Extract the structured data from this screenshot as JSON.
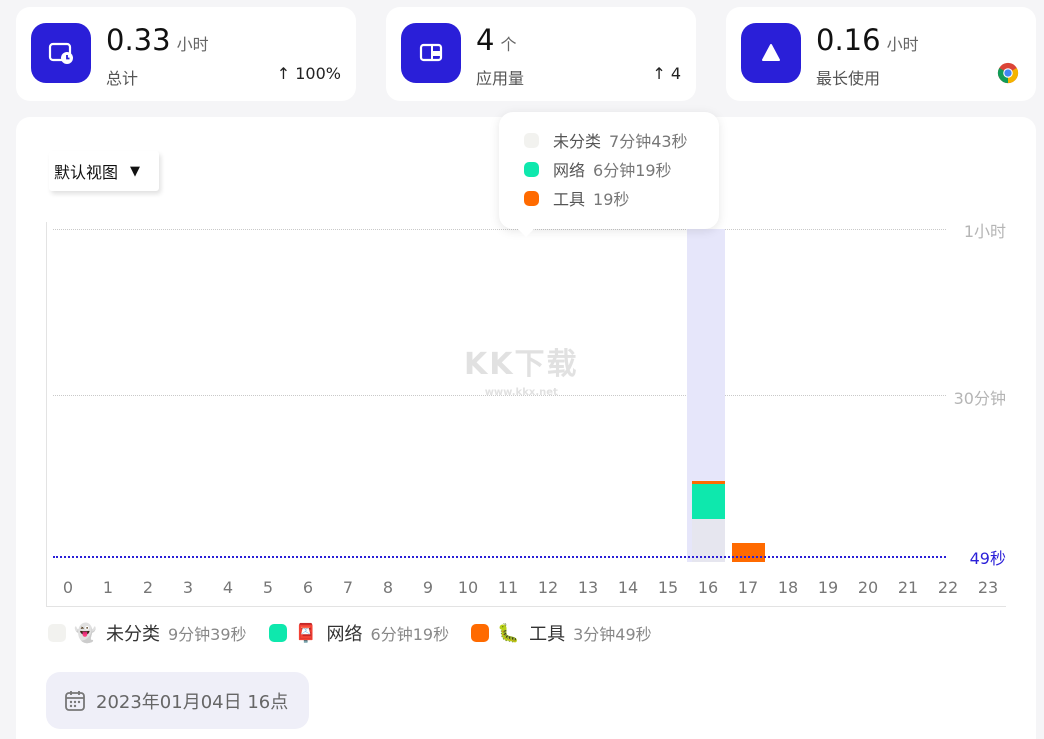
{
  "stats": {
    "total": {
      "value": "0.33",
      "unit": "小时",
      "label": "总计",
      "trend": "100%",
      "icon": "clock-screen-icon"
    },
    "apps": {
      "value": "4",
      "unit": "个",
      "label": "应用量",
      "trend": "4",
      "icon": "app-window-icon"
    },
    "longest": {
      "value": "0.16",
      "unit": "小时",
      "label": "最长使用",
      "icon": "triangle-icon",
      "app_icon": "chrome-icon"
    }
  },
  "view_select": {
    "value": "默认视图"
  },
  "tooltip": {
    "rows": [
      {
        "name": "未分类",
        "time": "7分钟43秒",
        "color": "#f2f2ef"
      },
      {
        "name": "网络",
        "time": "6分钟19秒",
        "color": "#0ee8ad"
      },
      {
        "name": "工具",
        "time": "19秒",
        "color": "#ff6a00"
      }
    ]
  },
  "chart_data": {
    "type": "bar",
    "stacked": true,
    "categories": [
      "0",
      "1",
      "2",
      "3",
      "4",
      "5",
      "6",
      "7",
      "8",
      "9",
      "10",
      "11",
      "12",
      "13",
      "14",
      "15",
      "16",
      "17",
      "18",
      "19",
      "20",
      "21",
      "22",
      "23"
    ],
    "y_ticks": [
      "1小时",
      "30分钟"
    ],
    "average_label": "49秒",
    "average_seconds": 49,
    "ylim_seconds": [
      0,
      3600
    ],
    "highlighted_category": "16",
    "series": [
      {
        "name": "未分类",
        "color": "#e6e6ef",
        "values_seconds": [
          0,
          0,
          0,
          0,
          0,
          0,
          0,
          0,
          0,
          0,
          0,
          0,
          0,
          0,
          0,
          0,
          463,
          0,
          0,
          0,
          0,
          0,
          0,
          0
        ]
      },
      {
        "name": "网络",
        "color": "#0ee8ad",
        "values_seconds": [
          0,
          0,
          0,
          0,
          0,
          0,
          0,
          0,
          0,
          0,
          0,
          0,
          0,
          0,
          0,
          0,
          379,
          0,
          0,
          0,
          0,
          0,
          0,
          0
        ]
      },
      {
        "name": "工具",
        "color": "#ff6a00",
        "values_seconds": [
          0,
          0,
          0,
          0,
          0,
          0,
          0,
          0,
          0,
          0,
          0,
          0,
          0,
          0,
          0,
          0,
          19,
          210,
          0,
          0,
          0,
          0,
          0,
          0
        ]
      }
    ],
    "legend_position": "bottom"
  },
  "legend": [
    {
      "name": "未分类",
      "time": "9分钟39秒",
      "emoji": "👻",
      "color": "#f2f2ef"
    },
    {
      "name": "网络",
      "time": "6分钟19秒",
      "emoji": "📮",
      "color": "#0ee8ad"
    },
    {
      "name": "工具",
      "time": "3分钟49秒",
      "emoji": "🐛",
      "color": "#ff6a00"
    }
  ],
  "date_chip": {
    "text": "2023年01月04日 16点",
    "icon": "calendar-icon"
  },
  "watermark": {
    "main": "KK下载",
    "sub": "www.kkx.net"
  },
  "colors": {
    "accent": "#2a1fd8"
  }
}
